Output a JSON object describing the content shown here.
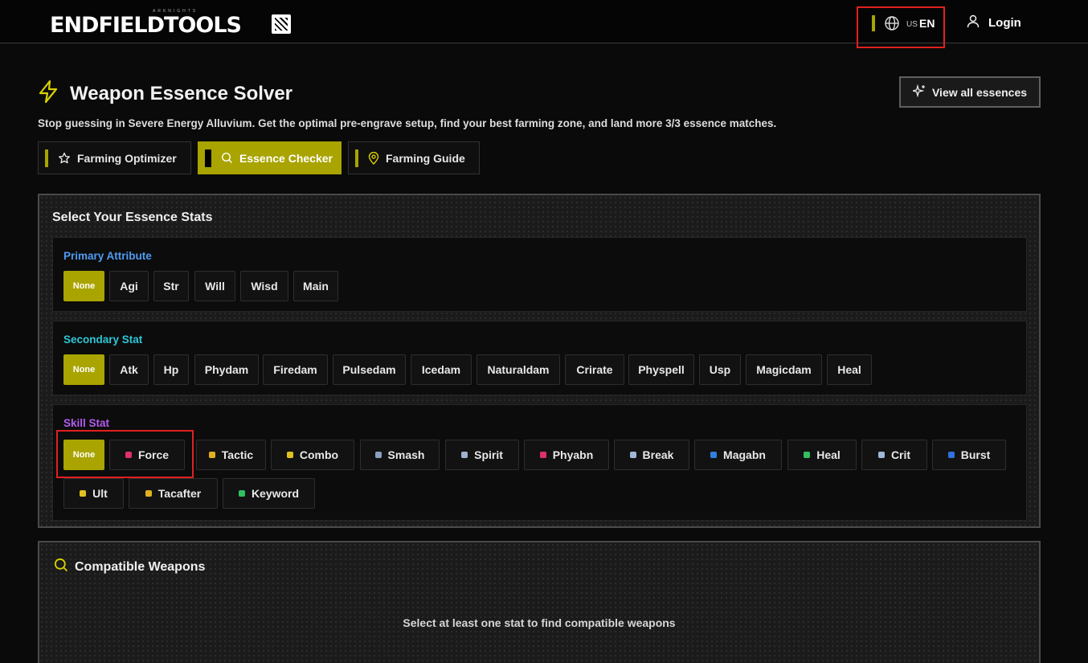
{
  "header": {
    "logo_text": "ENDFIELDTOOLS",
    "logo_subtext": "ARKNIGHTS",
    "lang_code": "US",
    "lang_label": "EN",
    "login_label": "Login"
  },
  "page": {
    "title": "Weapon Essence Solver",
    "subtitle": "Stop guessing in Severe Energy Alluvium. Get the optimal pre-engrave setup, find your best farming zone, and land more 3/3 essence matches.",
    "view_all_label": "View all essences"
  },
  "tabs": [
    {
      "label": "Farming Optimizer",
      "active": false
    },
    {
      "label": "Essence Checker",
      "active": true
    },
    {
      "label": "Farming Guide",
      "active": false
    }
  ],
  "stats_panel": {
    "title": "Select Your Essence Stats",
    "primary": {
      "label": "Primary Attribute",
      "color": "#4f9cf2",
      "options": [
        "None",
        "Agi",
        "Str",
        "Will",
        "Wisd",
        "Main"
      ]
    },
    "secondary": {
      "label": "Secondary Stat",
      "color": "#2ec7d6",
      "options": [
        "None",
        "Atk",
        "Hp",
        "Phydam",
        "Firedam",
        "Pulsedam",
        "Icedam",
        "Naturaldam",
        "Crirate",
        "Physpell",
        "Usp",
        "Magicdam",
        "Heal"
      ]
    },
    "skill": {
      "label": "Skill Stat",
      "color": "#b35cf0",
      "options": [
        "None",
        "Force",
        "Tactic",
        "Combo",
        "Smash",
        "Spirit",
        "Phyabn",
        "Break",
        "Magabn",
        "Heal",
        "Crit",
        "Burst",
        "Ult",
        "Tacafter",
        "Keyword"
      ],
      "icon_colors": [
        "",
        "#e0306a",
        "#e0b020",
        "#e0c020",
        "#8aa0c0",
        "#a0b0d0",
        "#e0306a",
        "#a0b8d8",
        "#3080e0",
        "#30c060",
        "#a0b8d8",
        "#3070e0",
        "#e0c020",
        "#e0b020",
        "#30c060"
      ]
    }
  },
  "compatible": {
    "title": "Compatible Weapons",
    "empty_message": "Select at least one stat to find compatible weapons"
  },
  "accent_color": "#a9a400"
}
